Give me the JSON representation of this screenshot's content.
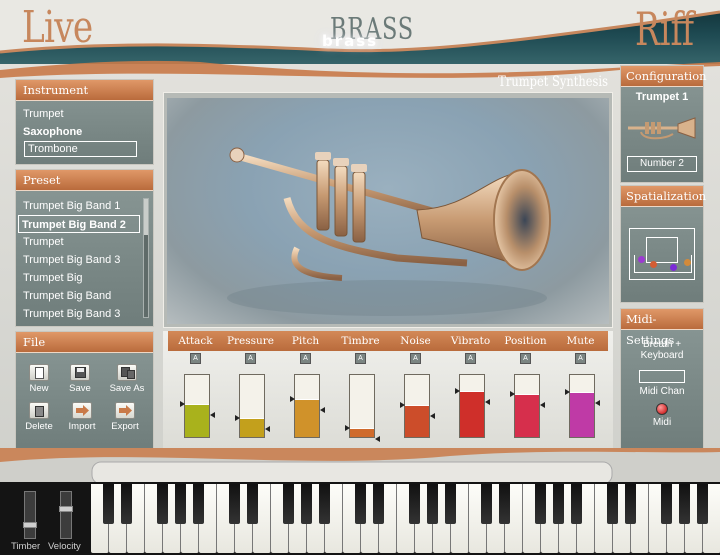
{
  "header": {
    "left_logo": "Live",
    "right_logo": "Riff",
    "product_back": "BRASS",
    "product_front": "brass"
  },
  "instrument": {
    "title": "Instrument",
    "items": [
      {
        "label": "Trumpet",
        "state": "normal"
      },
      {
        "label": "Saxophone",
        "state": "bold"
      },
      {
        "label": "Trombone",
        "state": "boxed"
      }
    ]
  },
  "preset": {
    "title": "Preset",
    "items": [
      {
        "label": "Trumpet Big Band 1",
        "selected": false
      },
      {
        "label": "Trumpet Big Band 2",
        "selected": true
      },
      {
        "label": "Trumpet",
        "selected": false
      },
      {
        "label": "Trumpet Big Band 3",
        "selected": false
      },
      {
        "label": "Trumpet Big",
        "selected": false
      },
      {
        "label": "Trumpet Big Band",
        "selected": false
      },
      {
        "label": "Trumpet Big Band 3",
        "selected": false
      }
    ]
  },
  "file": {
    "title": "File",
    "buttons": [
      {
        "name": "new",
        "label": "New",
        "icon": "new-icon"
      },
      {
        "name": "save",
        "label": "Save",
        "icon": "save-icon"
      },
      {
        "name": "save-as",
        "label": "Save As",
        "icon": "save-as-icon"
      },
      {
        "name": "delete",
        "label": "Delete",
        "icon": "delete-icon"
      },
      {
        "name": "import",
        "label": "Import",
        "icon": "import-arrow-icon"
      },
      {
        "name": "export",
        "label": "Export",
        "icon": "export-arrow-icon"
      }
    ]
  },
  "center": {
    "title": "Trumpet Synthesis"
  },
  "params": [
    {
      "label": "Attack",
      "a": "A",
      "fill": 0.54,
      "color": "#a9b21c"
    },
    {
      "label": "Pressure",
      "a": "A",
      "fill": 0.3,
      "color": "#c3a01c"
    },
    {
      "label": "Pitch",
      "a": "A",
      "fill": 0.62,
      "color": "#d0922a"
    },
    {
      "label": "Timbre",
      "a": "A",
      "fill": 0.14,
      "color": "#cf6b2c"
    },
    {
      "label": "Noise",
      "a": "A",
      "fill": 0.52,
      "color": "#cc4d2a"
    },
    {
      "label": "Vibrato",
      "a": "A",
      "fill": 0.74,
      "color": "#cf2f2a"
    },
    {
      "label": "Position",
      "a": "A",
      "fill": 0.7,
      "color": "#d62f4c"
    },
    {
      "label": "Mute",
      "a": "A",
      "fill": 0.72,
      "color": "#bf3aa6"
    }
  ],
  "configuration": {
    "title": "Configuration",
    "instrument_name": "Trumpet 1",
    "number_label": "Number 2"
  },
  "spatialization": {
    "title": "Spatialization",
    "dot_colors": [
      "#9c3ad1",
      "#d35d34",
      "#7b2bd6",
      "#d38a3a"
    ]
  },
  "midi": {
    "title": "Midi-Settings",
    "mode_line1": "Breath +",
    "mode_line2": "Keyboard",
    "chan_label": "Midi Chan",
    "midi_label": "Midi"
  },
  "bottom": {
    "timber_label": "Timber",
    "velocity_label": "Velocity"
  },
  "colors": {
    "accent_orange": "#c97a49",
    "panel_gray": "#7b8886",
    "header_teal": "#1e4a52"
  }
}
